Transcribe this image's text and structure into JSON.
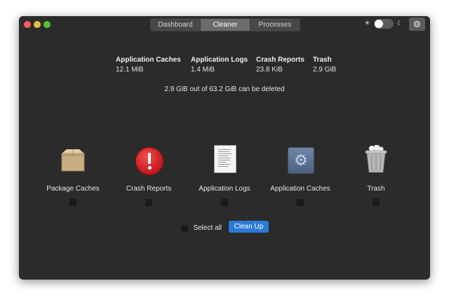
{
  "window": {
    "tabs": [
      {
        "label": "Dashboard",
        "active": false
      },
      {
        "label": "Cleaner",
        "active": true
      },
      {
        "label": "Processes",
        "active": false
      }
    ],
    "theme_toggle": {
      "dark_mode": false
    }
  },
  "stats": [
    {
      "label": "Application Caches",
      "value": "12.1 MiB"
    },
    {
      "label": "Application Logs",
      "value": "1.4 MiB"
    },
    {
      "label": "Crash Reports",
      "value": "23.8 KiB"
    },
    {
      "label": "Trash",
      "value": "2.9 GiB"
    }
  ],
  "summary": "2.9 GiB out of 63.2 GiB can be deleted",
  "items": [
    {
      "label": "Package Caches",
      "icon": "package-box-icon",
      "checked": false
    },
    {
      "label": "Crash Reports",
      "icon": "alert-icon",
      "checked": false
    },
    {
      "label": "Application Logs",
      "icon": "document-icon",
      "checked": false
    },
    {
      "label": "Application Caches",
      "icon": "gear-icon",
      "checked": false
    },
    {
      "label": "Trash",
      "icon": "trash-icon",
      "checked": false
    }
  ],
  "select_all": {
    "label": "Select all",
    "checked": false
  },
  "cleanup_button": {
    "label": "Clean Up"
  },
  "colors": {
    "accent": "#2a7ad6",
    "background": "#2b2b2b"
  }
}
